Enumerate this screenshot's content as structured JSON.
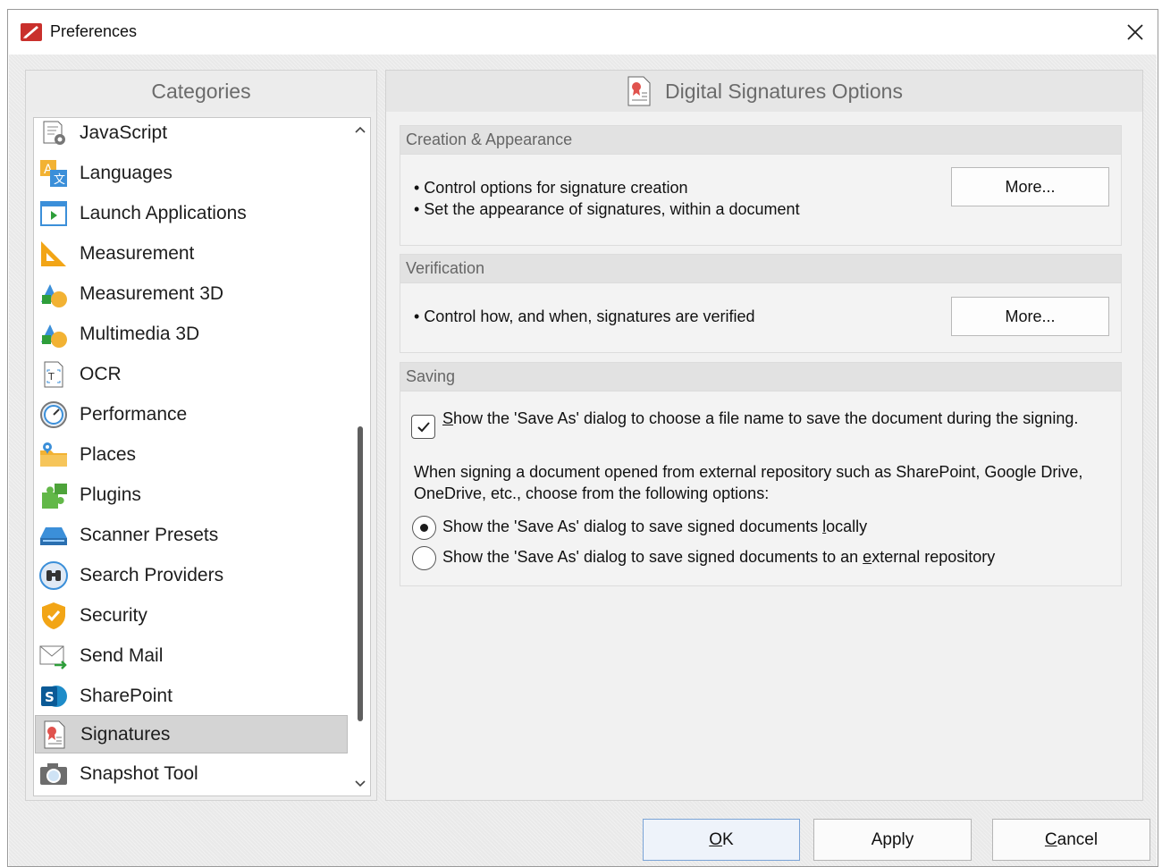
{
  "window": {
    "title": "Preferences"
  },
  "categories": {
    "header": "Categories",
    "items": [
      {
        "label": "JavaScript",
        "icon": "javascript-icon"
      },
      {
        "label": "Languages",
        "icon": "languages-icon"
      },
      {
        "label": "Launch Applications",
        "icon": "launch-applications-icon"
      },
      {
        "label": "Measurement",
        "icon": "measurement-icon"
      },
      {
        "label": "Measurement 3D",
        "icon": "measurement-3d-icon"
      },
      {
        "label": "Multimedia 3D",
        "icon": "multimedia-3d-icon"
      },
      {
        "label": "OCR",
        "icon": "ocr-icon"
      },
      {
        "label": "Performance",
        "icon": "performance-icon"
      },
      {
        "label": "Places",
        "icon": "places-icon"
      },
      {
        "label": "Plugins",
        "icon": "plugins-icon"
      },
      {
        "label": "Scanner Presets",
        "icon": "scanner-icon"
      },
      {
        "label": "Search Providers",
        "icon": "search-providers-icon"
      },
      {
        "label": "Security",
        "icon": "security-shield-icon"
      },
      {
        "label": "Send Mail",
        "icon": "send-mail-icon"
      },
      {
        "label": "SharePoint",
        "icon": "sharepoint-icon"
      },
      {
        "label": "Signatures",
        "icon": "signatures-icon",
        "selected": true
      },
      {
        "label": "Snapshot Tool",
        "icon": "camera-icon"
      }
    ]
  },
  "options": {
    "title": "Digital Signatures Options",
    "creation": {
      "title": "Creation & Appearance",
      "bullets": [
        "• Control options for signature creation",
        "• Set the appearance of signatures, within a document"
      ],
      "button": "More..."
    },
    "verification": {
      "title": "Verification",
      "bullets": [
        "• Control how, and when, signatures are verified"
      ],
      "button": "More..."
    },
    "saving": {
      "title": "Saving",
      "checkbox": {
        "first_char": "S",
        "rest": "how the 'Save As' dialog to choose a file name to save the document during the signing.",
        "checked": true
      },
      "paragraph": "When signing a document opened from external repository such as SharePoint, Google Drive, OneDrive, etc., choose from the following options:",
      "radio1": {
        "before": "Show the 'Save As' dialog to save signed documents ",
        "accel": "l",
        "after": "ocally",
        "selected": true
      },
      "radio2": {
        "before": "Show the 'Save As' dialog to save signed documents to an ",
        "accel": "e",
        "after": "xternal repository",
        "selected": false
      }
    }
  },
  "buttons": {
    "ok": {
      "accel": "O",
      "rest": "K"
    },
    "apply": "Apply",
    "cancel": {
      "accel": "C",
      "rest": "ancel"
    }
  },
  "colors": {
    "selection": "#d4d4d4",
    "ok_border": "#7aa3d6",
    "brand_red": "#c9302c"
  }
}
